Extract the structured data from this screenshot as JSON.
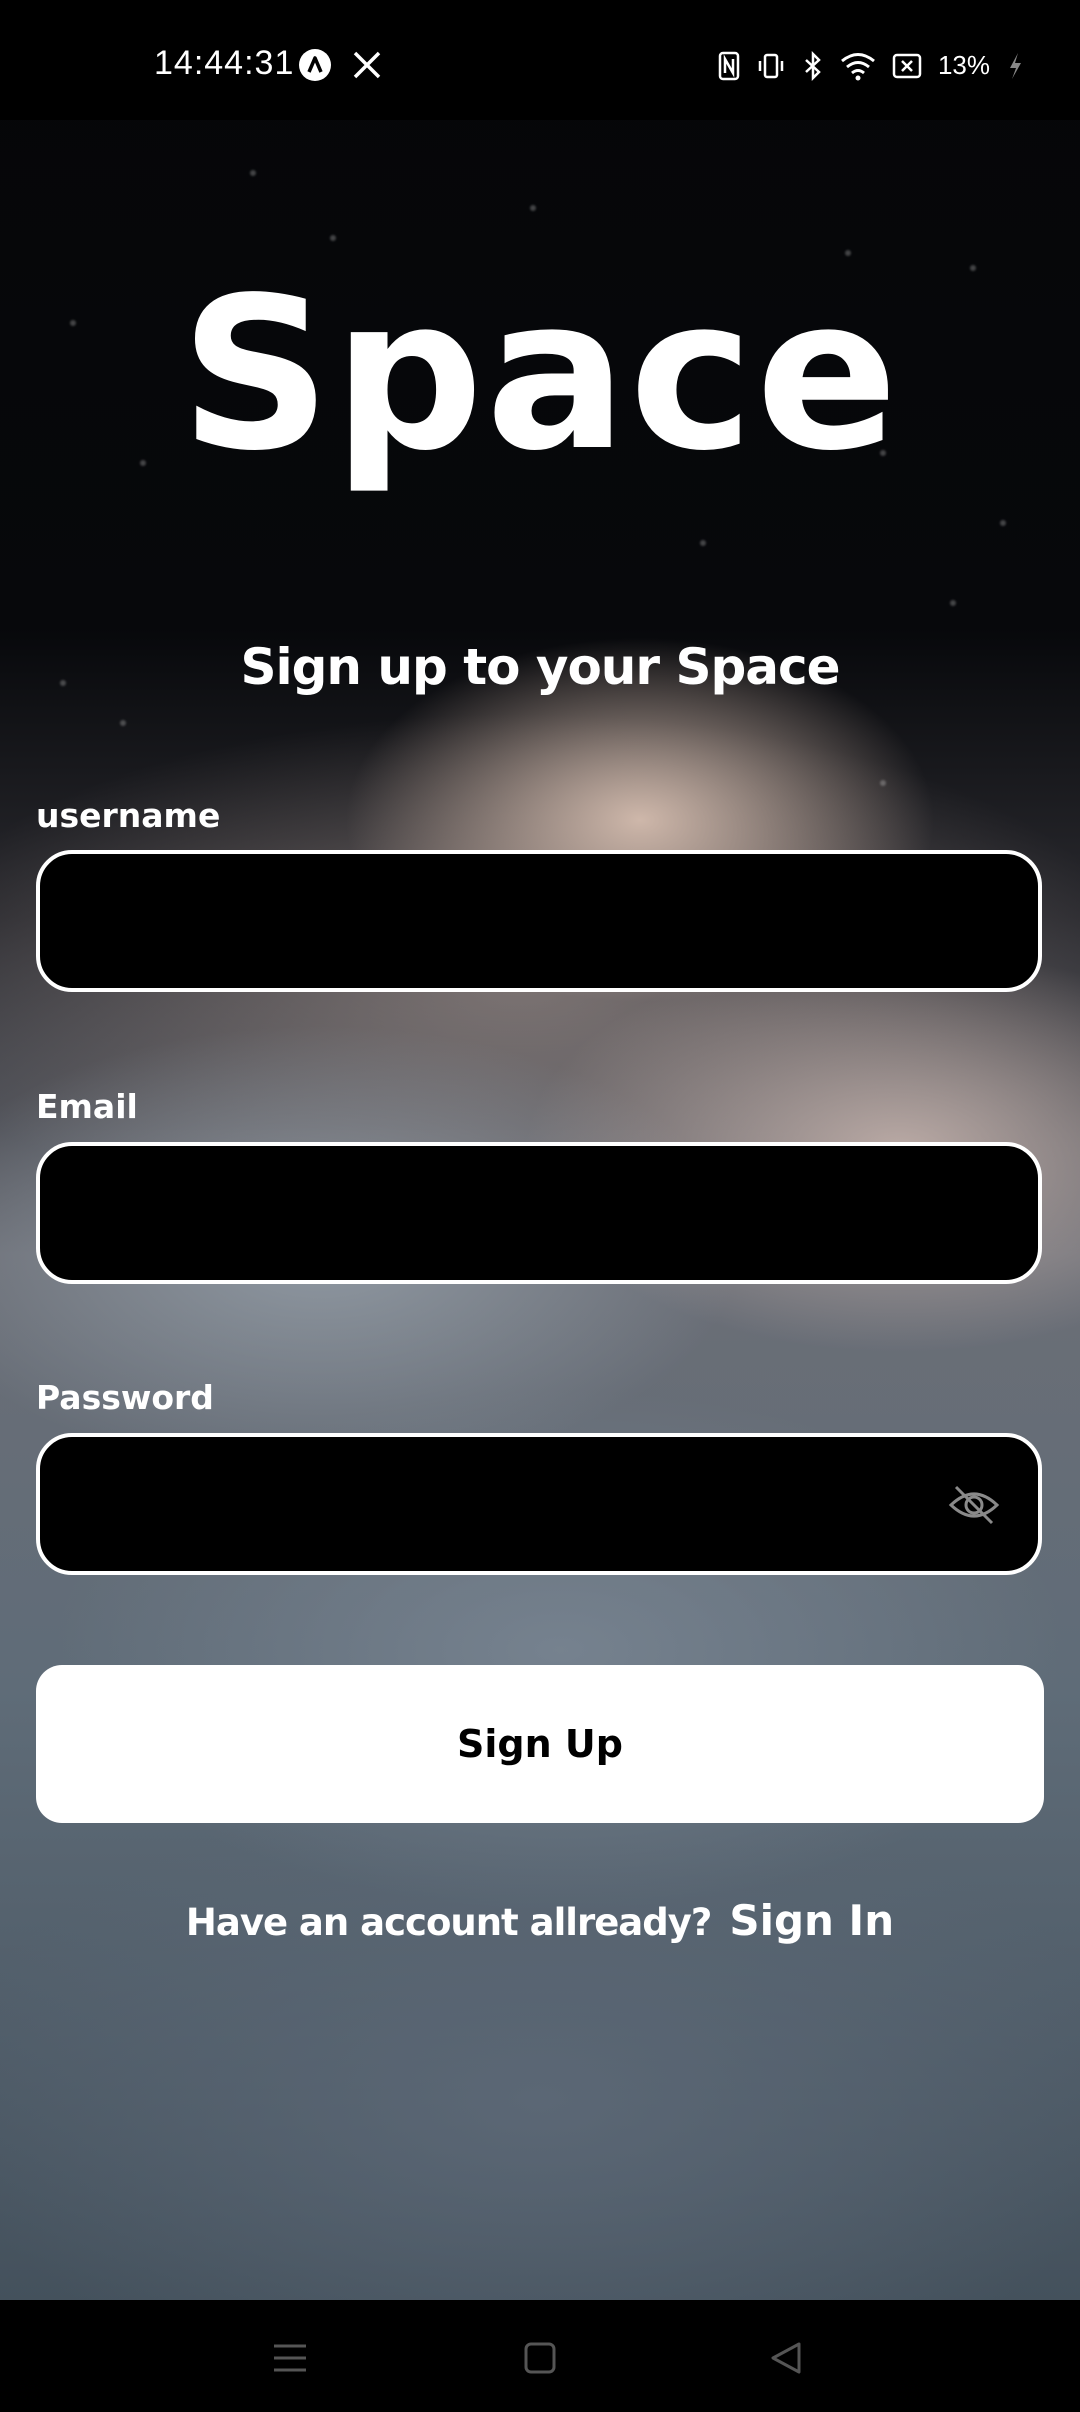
{
  "status_bar": {
    "time": "14:44:31",
    "battery": "13%",
    "icons": [
      "app-a-icon",
      "x-logo-icon",
      "nfc-icon",
      "vibrate-icon",
      "bluetooth-icon",
      "wifi-icon",
      "battery-saver-icon",
      "charging-icon"
    ]
  },
  "app": {
    "logo": "Space",
    "subtitle": "Sign up to your Space"
  },
  "form": {
    "username_label": "username",
    "email_label": "Email",
    "password_label": "Password",
    "signup_button": "Sign Up"
  },
  "footer": {
    "question": "Have an account allready?",
    "signin_link": "Sign In"
  },
  "nav": {
    "icons": [
      "menu-icon",
      "home-icon",
      "back-icon"
    ]
  }
}
